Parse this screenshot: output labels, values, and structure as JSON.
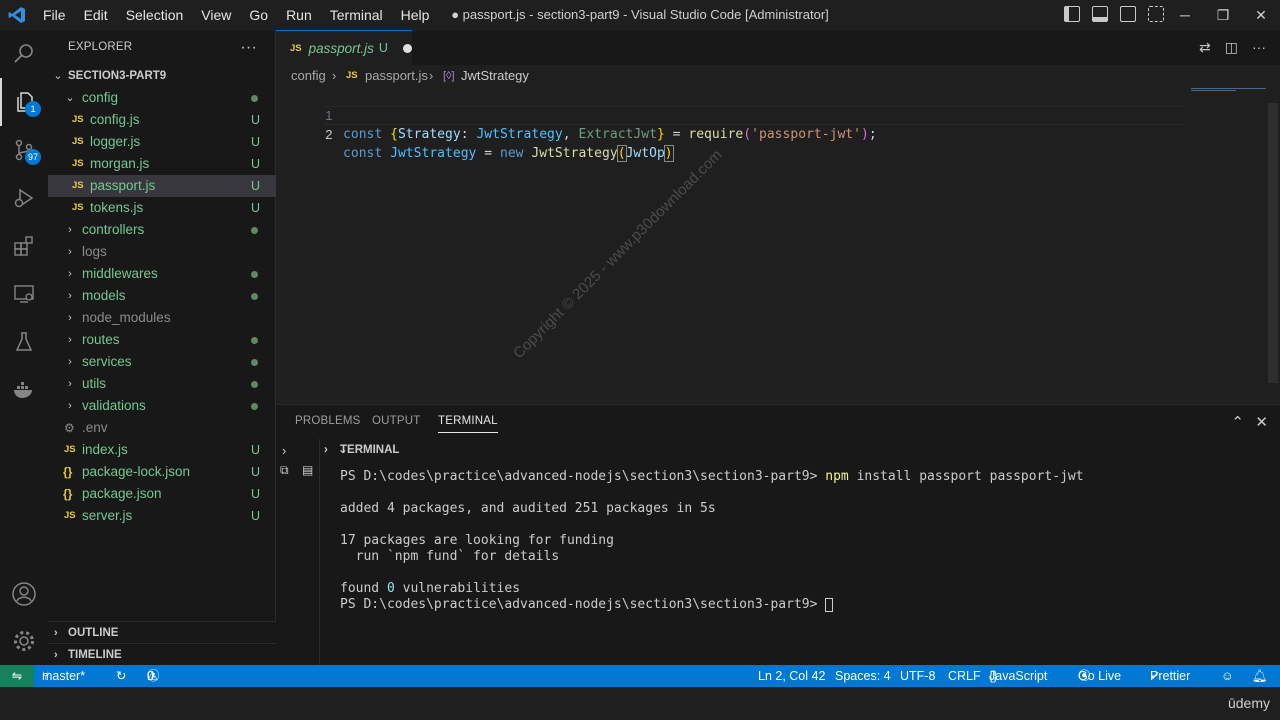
{
  "titlebar": {
    "menu": [
      "File",
      "Edit",
      "Selection",
      "View",
      "Go",
      "Run",
      "Terminal",
      "Help"
    ],
    "title": "● passport.js - section3-part9 - Visual Studio Code [Administrator]"
  },
  "activity": {
    "explorer_badge": "1",
    "scm_badge": "97"
  },
  "explorer": {
    "header": "EXPLORER",
    "root": "SECTION3-PART9",
    "items": [
      {
        "label": "config",
        "deco": ""
      },
      {
        "label": "config.js",
        "deco": "U"
      },
      {
        "label": "logger.js",
        "deco": "U"
      },
      {
        "label": "morgan.js",
        "deco": "U"
      },
      {
        "label": "passport.js",
        "deco": "U"
      },
      {
        "label": "tokens.js",
        "deco": "U"
      },
      {
        "label": "controllers",
        "deco": ""
      },
      {
        "label": "logs",
        "deco": ""
      },
      {
        "label": "middlewares",
        "deco": ""
      },
      {
        "label": "models",
        "deco": ""
      },
      {
        "label": "node_modules",
        "deco": ""
      },
      {
        "label": "routes",
        "deco": ""
      },
      {
        "label": "services",
        "deco": ""
      },
      {
        "label": "utils",
        "deco": ""
      },
      {
        "label": "validations",
        "deco": ""
      },
      {
        "label": ".env",
        "deco": ""
      },
      {
        "label": "index.js",
        "deco": "U"
      },
      {
        "label": "package-lock.json",
        "deco": "U"
      },
      {
        "label": "package.json",
        "deco": "U"
      },
      {
        "label": "server.js",
        "deco": "U"
      }
    ],
    "outline": "OUTLINE",
    "timeline": "TIMELINE"
  },
  "tab": {
    "name": "passport.js",
    "status": "U"
  },
  "breadcrumb": {
    "folder": "config",
    "file": "passport.js",
    "symbol": "JwtStrategy"
  },
  "editor": {
    "line_numbers": [
      "1",
      "2"
    ]
  },
  "panel": {
    "tabs": [
      "PROBLEMS",
      "OUTPUT",
      "TERMINAL"
    ],
    "terminal_header": "TERMINAL",
    "prompt": "PS D:\\codes\\practice\\advanced-nodejs\\section3\\section3-part9> ",
    "command": "npm",
    "command_args": " install passport passport-jwt",
    "out1": "added 4 packages, and audited 251 packages in 5s",
    "out2": "17 packages are looking for funding",
    "out3": "  run `npm fund` for details",
    "out4_pre": "found ",
    "out4_num": "0",
    "out4_post": " vulnerabilities",
    "prompt2": "PS D:\\codes\\practice\\advanced-nodejs\\section3\\section3-part9> "
  },
  "statusbar": {
    "branch": "master*",
    "errors": "0",
    "warnings": "0",
    "position": "Ln 2, Col 42",
    "spaces": "Spaces: 4",
    "encoding": "UTF-8",
    "eol": "CRLF",
    "language": "JavaScript",
    "golive": "Go Live",
    "prettier": "Prettier"
  },
  "watermark": "Copyright © 2025 - www.p30download.com",
  "brand": "ūdemy",
  "colors": {
    "accent": "#0078d4",
    "untracked": "#73c991",
    "remote": "#16825d"
  }
}
